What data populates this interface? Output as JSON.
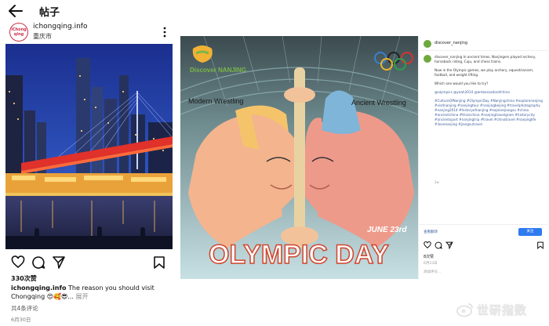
{
  "left_post": {
    "page_title": "帖子",
    "account": {
      "avatar_text": "iChong qing",
      "name": "ichongqing.info",
      "location": "重庆市"
    },
    "likes": "330次赞",
    "caption_user": "ichongqing.info",
    "caption_text": " The reason you should visit Chongqing 😍🥰😎... ",
    "caption_more": "展开",
    "comments": "共4条评论",
    "date": "6月30日",
    "icons": [
      "back-icon",
      "more-icon",
      "heart-icon",
      "comment-icon",
      "share-icon",
      "bookmark-icon"
    ]
  },
  "right_post": {
    "poster": {
      "logo_text": "Discover NANJING",
      "label_left": "Modern Wrestling",
      "label_right": "Ancient Wrestling",
      "date": "JUNE 23rd",
      "title": "OLYMPIC DAY"
    },
    "sidebar": {
      "account_name": "discover_nanjing",
      "para1": "discover_nanjing In ancient times, Nanjingers played archery, horseback riding, Cuju, and chess trains.",
      "para2": "Now in the Olympic games, we play archery, equestrianism, football, and weight lifting.",
      "para3": "Which one would you like to try?",
      "credits": "@olympics @yeah2014 @ambassadorofchina",
      "tags": "#CultureOfNanjing #OlympicDay #Nanjingchina #explorenanjing #visitnanjing #nanjingtour #nanjingbeijing #travelphotography #nanjing2014 #historyofnanjing #explorejiangsu #china #ancientchina #thisischina #nanjingtravelgram #historycity #ancientsport #nanjingtrip #travel #chinatravel #nanjinglife #ilovenanjing #jiangsutravel",
      "small": "2w",
      "translate": "查看翻译",
      "button": "关注",
      "likes": "8次赞",
      "date": "6月23日",
      "comment_placeholder": "添加评论..."
    }
  },
  "watermark": "世研指数"
}
